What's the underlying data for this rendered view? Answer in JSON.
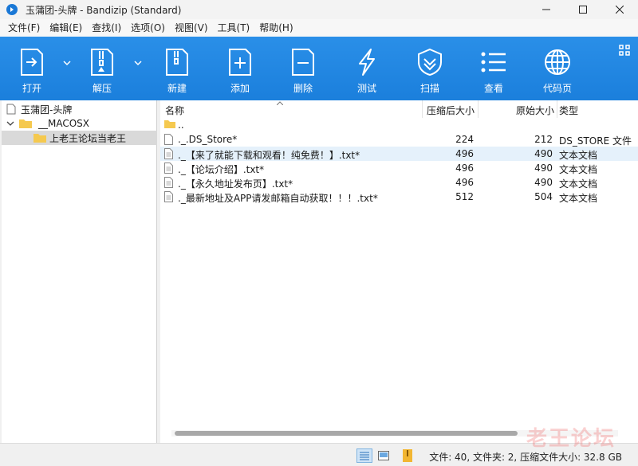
{
  "window": {
    "title": "玉蒲团-头牌 - Bandizip (Standard)"
  },
  "menu": [
    "文件(F)",
    "编辑(E)",
    "查找(I)",
    "选项(O)",
    "视图(V)",
    "工具(T)",
    "帮助(H)"
  ],
  "toolbar": {
    "open": "打开",
    "extract": "解压",
    "new": "新建",
    "add": "添加",
    "delete": "删除",
    "test": "测试",
    "scan": "扫描",
    "view": "查看",
    "codepage": "代码页"
  },
  "tree": {
    "root": "玉蒲团-头牌",
    "macosx": "__MACOSX",
    "child": "上老王论坛当老王"
  },
  "list": {
    "headers": {
      "name": "名称",
      "compressed": "压缩后大小",
      "original": "原始大小",
      "type": "类型"
    },
    "parent": "..",
    "rows": [
      {
        "name": "._.DS_Store*",
        "compressed": "224",
        "original": "212",
        "type": "DS_STORE 文件"
      },
      {
        "name": "._【来了就能下载和观看！纯免费！】.txt*",
        "compressed": "496",
        "original": "490",
        "type": "文本文档"
      },
      {
        "name": "._【论坛介绍】.txt*",
        "compressed": "496",
        "original": "490",
        "type": "文本文档"
      },
      {
        "name": "._【永久地址发布页】.txt*",
        "compressed": "496",
        "original": "490",
        "type": "文本文档"
      },
      {
        "name": "._最新地址及APP请发邮箱自动获取！！！.txt*",
        "compressed": "512",
        "original": "504",
        "type": "文本文档"
      }
    ]
  },
  "status": {
    "text": "文件: 40, 文件夹: 2, 压缩文件大小: 32.8 GB"
  },
  "watermark": "老王论坛",
  "colors": {
    "toolbar": "#1e88e5",
    "selection": "#e5f1fb",
    "accent": "#1a78d6"
  }
}
